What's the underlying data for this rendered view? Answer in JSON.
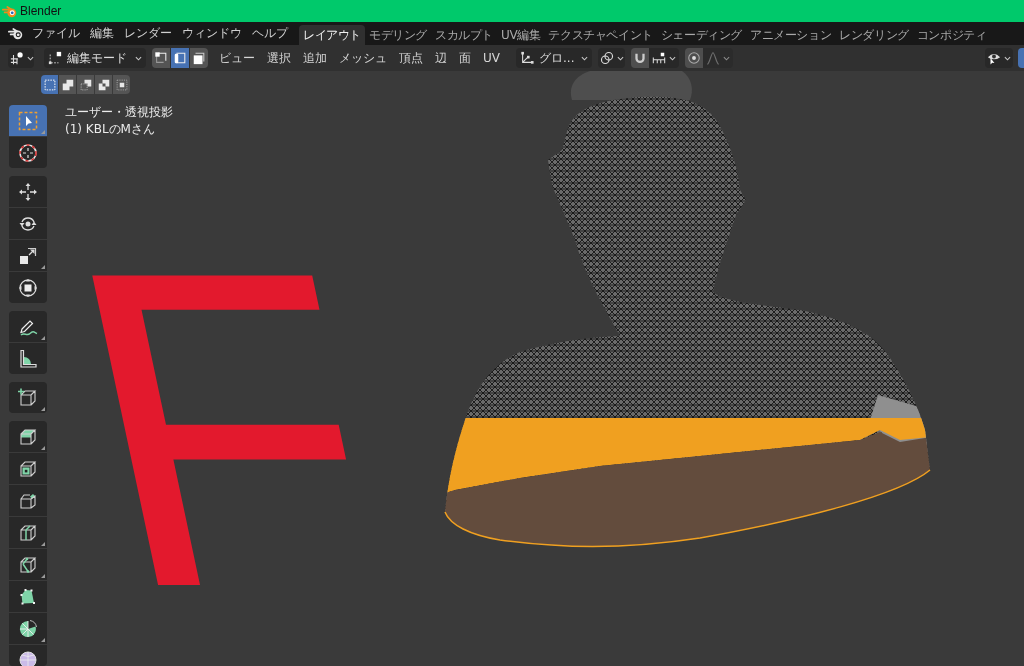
{
  "window": {
    "title": "Blender"
  },
  "menu_bar": {
    "menus": [
      "ファイル",
      "編集",
      "レンダー",
      "ウィンドウ",
      "ヘルプ"
    ],
    "workspace_tabs": [
      {
        "label": "レイアウト",
        "selected": true
      },
      {
        "label": "モデリング",
        "selected": false
      },
      {
        "label": "スカルプト",
        "selected": false
      },
      {
        "label": "UV編集",
        "selected": false
      },
      {
        "label": "テクスチャペイント",
        "selected": false
      },
      {
        "label": "シェーディング",
        "selected": false
      },
      {
        "label": "アニメーション",
        "selected": false
      },
      {
        "label": "レンダリング",
        "selected": false
      },
      {
        "label": "コンポジティ",
        "selected": false
      }
    ]
  },
  "header": {
    "mode": "編集モード",
    "select_modes": [
      {
        "kind": "vertex",
        "selected": false
      },
      {
        "kind": "edge",
        "selected": true
      },
      {
        "kind": "face",
        "selected": false
      }
    ],
    "menus": [
      "ビュー",
      "選択",
      "追加",
      "メッシュ",
      "頂点",
      "辺",
      "面",
      "UV"
    ],
    "orientation": "グロ...",
    "snap": {
      "on": false
    },
    "proportional_editing": {
      "on": false
    }
  },
  "tool_settings": {
    "selection_modes": [
      {
        "kind": "new",
        "selected": true
      },
      {
        "kind": "extend",
        "selected": false
      },
      {
        "kind": "subtract",
        "selected": false
      },
      {
        "kind": "invert",
        "selected": false
      },
      {
        "kind": "intersect",
        "selected": false
      }
    ]
  },
  "toolbar": {
    "groups": [
      {
        "tools": [
          {
            "kind": "select_box",
            "selected": true,
            "subtools": true
          },
          {
            "kind": "cursor",
            "selected": false,
            "subtools": false
          }
        ]
      },
      {
        "tools": [
          {
            "kind": "move",
            "selected": false,
            "subtools": false
          },
          {
            "kind": "rotate",
            "selected": false,
            "subtools": false
          },
          {
            "kind": "scale",
            "selected": false,
            "subtools": true
          },
          {
            "kind": "transform",
            "selected": false,
            "subtools": false
          }
        ]
      },
      {
        "tools": [
          {
            "kind": "annotate",
            "selected": false,
            "subtools": true
          },
          {
            "kind": "measure",
            "selected": false,
            "subtools": false
          }
        ]
      },
      {
        "tools": [
          {
            "kind": "add_cube",
            "selected": false,
            "subtools": true
          }
        ]
      },
      {
        "tools": [
          {
            "kind": "extrude",
            "selected": false,
            "subtools": true
          },
          {
            "kind": "inset",
            "selected": false,
            "subtools": false
          },
          {
            "kind": "bevel",
            "selected": false,
            "subtools": false
          },
          {
            "kind": "loop_cut",
            "selected": false,
            "subtools": true
          },
          {
            "kind": "knife",
            "selected": false,
            "subtools": true
          },
          {
            "kind": "poly_build",
            "selected": false,
            "subtools": false
          },
          {
            "kind": "spin",
            "selected": false,
            "subtools": true
          },
          {
            "kind": "smooth",
            "selected": false,
            "subtools": false
          }
        ]
      }
    ]
  },
  "viewport": {
    "view_name": "ユーザー・透視投影",
    "object_name": "(1) KBLのMさん",
    "annotation": "F"
  }
}
